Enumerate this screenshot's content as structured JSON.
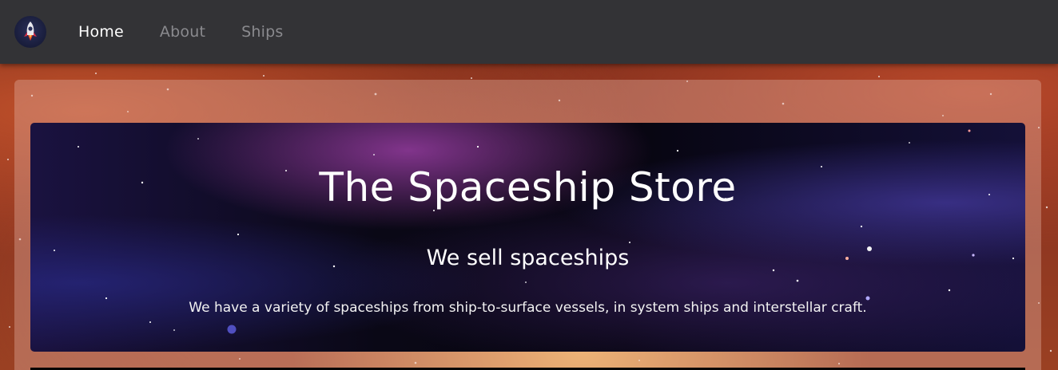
{
  "navbar": {
    "logo": {
      "icon": "rocket-icon"
    },
    "links": [
      {
        "label": "Home",
        "active": true
      },
      {
        "label": "About",
        "active": false
      },
      {
        "label": "Ships",
        "active": false
      }
    ]
  },
  "hero": {
    "title": "The Spaceship Store",
    "subtitle": "We sell spaceships",
    "description": "We have a variety of spaceships from ship-to-surface vessels, in system ships and interstellar craft."
  },
  "colors": {
    "navbar_bg": "#333336",
    "nav_active": "#ffffff",
    "nav_inactive": "#8a8a8e"
  }
}
